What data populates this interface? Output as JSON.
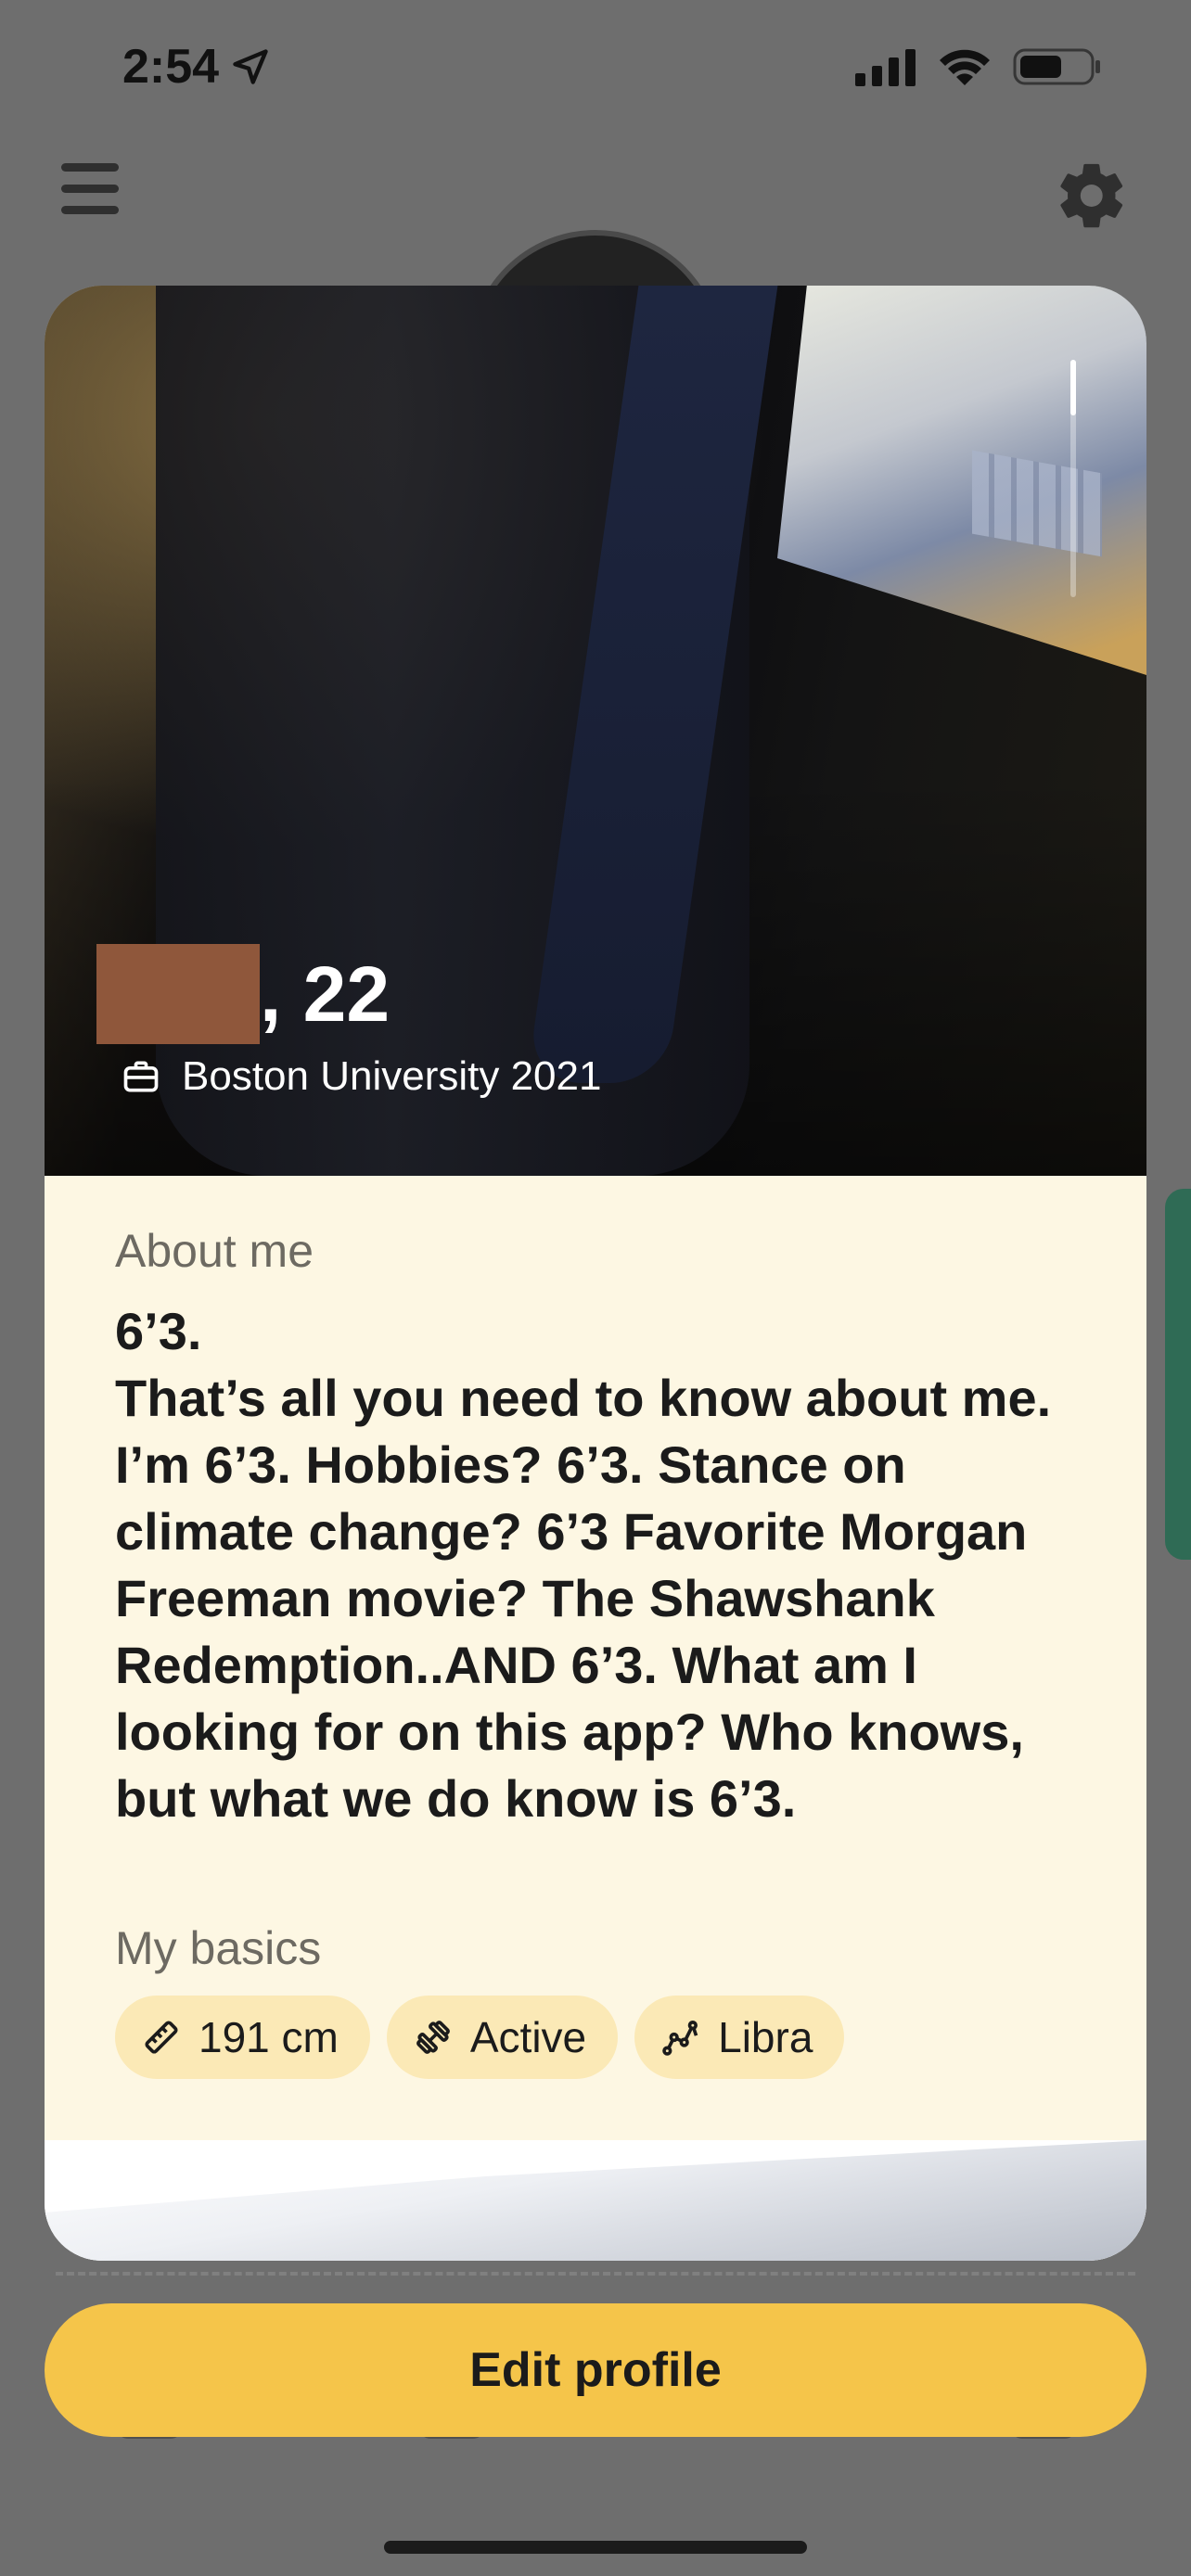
{
  "status_bar": {
    "time": "2:54",
    "icons": [
      "location-arrow-icon",
      "signal-icon",
      "wifi-icon",
      "battery-icon"
    ]
  },
  "nav": {
    "menu_icon": "menu-icon",
    "settings_icon": "gear-icon"
  },
  "profile": {
    "age_text": ", 22",
    "school": "Boston University 2021",
    "about_label": "About me",
    "about_lines": [
      "6’3.",
      "That’s all you need to know about me.",
      "I’m 6’3. Hobbies? 6’3. Stance on",
      "climate change? 6’3 Favorite Morgan",
      "Freeman movie? The Shawshank",
      "Redemption..AND 6’3. What am I",
      "looking for on this app? Who knows,",
      "but what we do know is 6’3."
    ],
    "basics_label": "My basics",
    "basics": [
      {
        "icon": "ruler-icon",
        "label": "191 cm"
      },
      {
        "icon": "dumbbell-icon",
        "label": "Active"
      },
      {
        "icon": "constellation-icon",
        "label": "Libra"
      }
    ]
  },
  "actions": {
    "edit_profile": "Edit profile"
  },
  "colors": {
    "accent": "#f5c54a",
    "about_bg": "#fdf7e3",
    "pill_bg": "#fbe9b6",
    "overlay": "#6e6e6e"
  }
}
